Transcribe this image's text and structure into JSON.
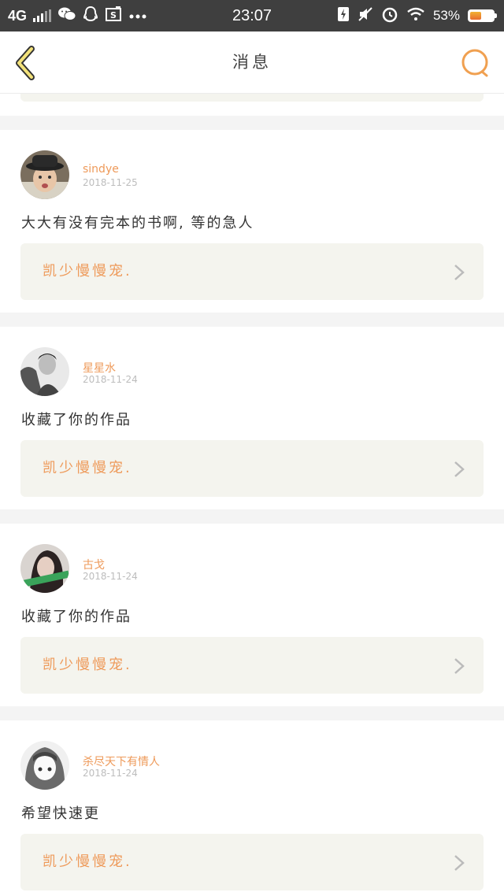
{
  "status_bar": {
    "network": "4G",
    "time": "23:07",
    "battery_percent": "53%",
    "icons": [
      "signal-icon",
      "wechat-icon",
      "qq-icon",
      "s-app-icon",
      "more-dots-icon",
      "charging-sim-icon",
      "mute-icon",
      "alarm-icon",
      "wifi-icon",
      "battery-icon"
    ]
  },
  "header": {
    "title": "消息",
    "back_icon": "chevron-left-icon",
    "search_icon": "search-icon",
    "accent_color": "#f0a050"
  },
  "messages": [
    {
      "username": "sindye",
      "date": "2018-11-25",
      "text": "大大有没有完本的书啊, 等的急人",
      "reference": "凯少慢慢宠."
    },
    {
      "username": "星星水",
      "date": "2018-11-24",
      "text": "收藏了你的作品",
      "reference": "凯少慢慢宠."
    },
    {
      "username": "古戈",
      "date": "2018-11-24",
      "text": "收藏了你的作品",
      "reference": "凯少慢慢宠."
    },
    {
      "username": "杀尽天下有情人",
      "date": "2018-11-24",
      "text": "希望快速更",
      "reference": "凯少慢慢宠."
    }
  ]
}
